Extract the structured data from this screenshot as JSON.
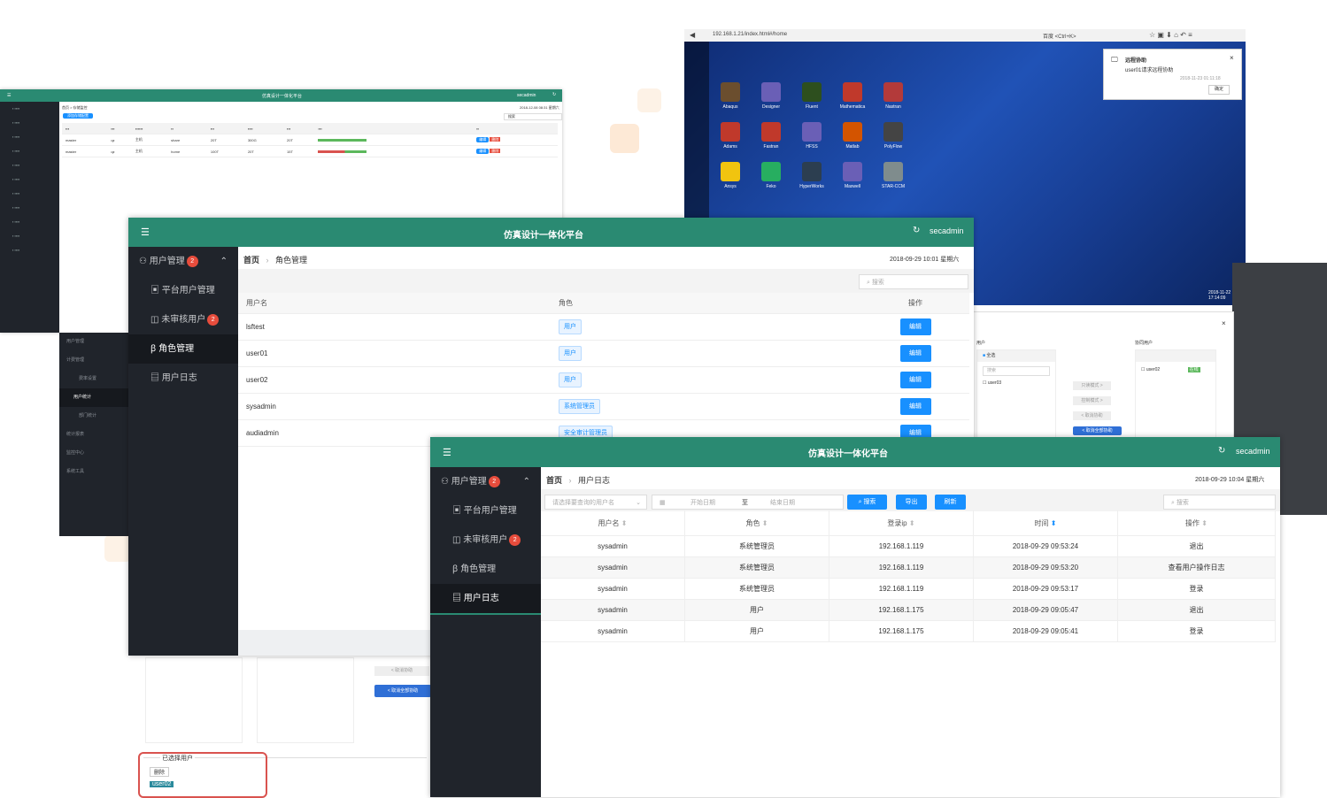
{
  "winA": {
    "title": "仿真设计一体化平台",
    "user": "secadmin",
    "date": "2018-12-08 08:31 星期六",
    "breadcrumb": "首页 > 存储监控",
    "add_button": "添加存储配置",
    "search": "搜索",
    "rows": [
      [
        "master",
        "qz",
        "主机",
        "share",
        "20T",
        "300G",
        "20T"
      ],
      [
        "master",
        "qz",
        "主机",
        "home",
        "100T",
        "20T",
        "15T"
      ]
    ],
    "edit": "编辑",
    "delete": "删除"
  },
  "remote": {
    "url": "192.168.1.21/index.html#/home",
    "search_hint": "百度 <Ctrl+K>",
    "icons": [
      {
        "label": "Abaqus",
        "color": "#6b4e2e"
      },
      {
        "label": "Designer",
        "color": "#6a5fb6"
      },
      {
        "label": "Fluent",
        "color": "#2d4f1e"
      },
      {
        "label": "Mathematica",
        "color": "#c0392b"
      },
      {
        "label": "Nastran",
        "color": "#b33a3a"
      },
      {
        "label": "Adams",
        "color": "#c0392b"
      },
      {
        "label": "Fastran",
        "color": "#c0392b"
      },
      {
        "label": "HFSS",
        "color": "#6a5fb6"
      },
      {
        "label": "Matlab",
        "color": "#d35400"
      },
      {
        "label": "PolyFlow",
        "color": "#444"
      },
      {
        "label": "Ansys",
        "color": "#f1c40f"
      },
      {
        "label": "Feko",
        "color": "#27ae60"
      },
      {
        "label": "HyperWorks",
        "color": "#2c3e50"
      },
      {
        "label": "Maxwell",
        "color": "#6a5fb6"
      },
      {
        "label": "STAR-CCM",
        "color": "#7f8c8d"
      }
    ],
    "notif_title": "远程协助",
    "notif_text": "user01请求远程协助",
    "notif_time": "2018-11-23 01:11:18",
    "notif_ok": "确定",
    "clock": "2018-11-22 17:14:09"
  },
  "dialog": {
    "left_title": "用户",
    "select_all": "全选",
    "search": "搜索",
    "user": "user03",
    "right_title": "协同用户",
    "right_user": "user02",
    "right_tag": "在线",
    "btn1": "只读模式 >",
    "btn2": "控制模式 >",
    "btn3": "< 取消协助",
    "btn4": "< 取消全部协助"
  },
  "fragment": {
    "items": [
      "用户管理",
      "计费管理",
      "费率设置",
      "用户统计",
      "部门统计",
      "统计报表",
      "监控中心",
      "系统工具"
    ]
  },
  "bottom": {
    "cancel": "< 取消协助",
    "cancel_all": "< 取消全部协助",
    "selected_title": "已选择用户",
    "delete": "删除",
    "chip": "user02"
  },
  "winB": {
    "title": "仿真设计一体化平台",
    "user": "secadmin",
    "breadcrumb_home": "首页",
    "breadcrumb_current": "角色管理",
    "datetime": "2018-09-29 10:01 星期六",
    "nav": {
      "user_mgmt": "用户管理",
      "badge": "2",
      "platform_users": "平台用户管理",
      "unreviewed": "未审核用户",
      "unreviewed_badge": "2",
      "roles": "角色管理",
      "logs": "用户日志"
    },
    "search_placeholder": "搜索",
    "columns": [
      "用户名",
      "角色",
      "操作"
    ],
    "rows": [
      {
        "name": "lsftest",
        "role": "用户"
      },
      {
        "name": "user01",
        "role": "用户"
      },
      {
        "name": "user02",
        "role": "用户"
      },
      {
        "name": "sysadmin",
        "role": "系统管理员"
      },
      {
        "name": "audiadmin",
        "role": "安全审计管理员"
      }
    ],
    "edit": "编辑"
  },
  "winC": {
    "title": "仿真设计一体化平台",
    "user": "secadmin",
    "breadcrumb_home": "首页",
    "breadcrumb_current": "用户日志",
    "datetime": "2018-09-29 10:04 星期六",
    "nav": {
      "user_mgmt": "用户管理",
      "badge": "2",
      "platform_users": "平台用户管理",
      "unreviewed": "未审核用户",
      "unreviewed_badge": "2",
      "roles": "角色管理",
      "logs": "用户日志"
    },
    "user_placeholder": "请选择要查询的用户名",
    "start_date": "开始日期",
    "to": "至",
    "end_date": "结束日期",
    "search_btn": "搜索",
    "export_btn": "导出",
    "refresh_btn": "刷新",
    "search_placeholder": "搜索",
    "columns": [
      "用户名",
      "角色",
      "登录ip",
      "时间",
      "操作"
    ],
    "rows": [
      [
        "sysadmin",
        "系统管理员",
        "192.168.1.119",
        "2018-09-29 09:53:24",
        "退出"
      ],
      [
        "sysadmin",
        "系统管理员",
        "192.168.1.119",
        "2018-09-29 09:53:20",
        "查看用户操作日志"
      ],
      [
        "sysadmin",
        "系统管理员",
        "192.168.1.119",
        "2018-09-29 09:53:17",
        "登录"
      ],
      [
        "sysadmin",
        "用户",
        "192.168.1.175",
        "2018-09-29 09:05:47",
        "退出"
      ],
      [
        "sysadmin",
        "用户",
        "192.168.1.175",
        "2018-09-29 09:05:41",
        "登录"
      ]
    ]
  }
}
